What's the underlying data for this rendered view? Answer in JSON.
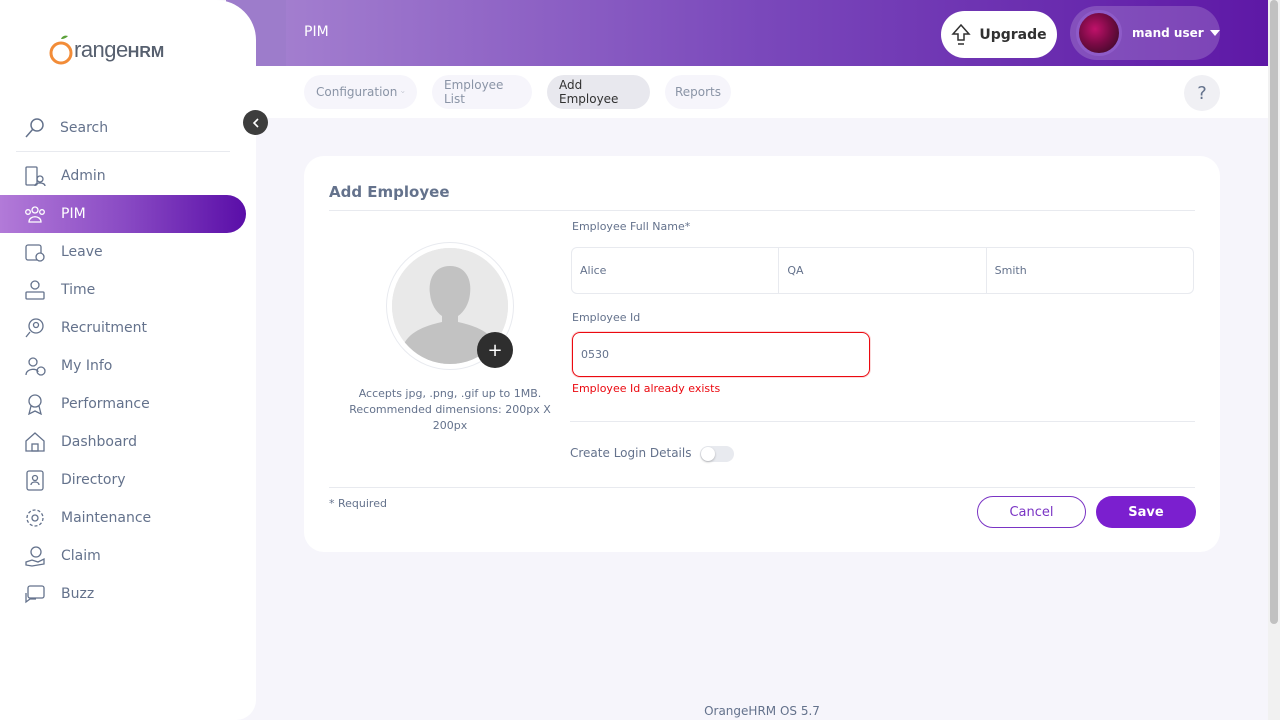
{
  "brand": {
    "o": "O",
    "rest": "range",
    "hrm": "HRM"
  },
  "sidebar": {
    "search_label": "Search",
    "items": [
      {
        "label": "Admin",
        "icon": "admin-icon"
      },
      {
        "label": "PIM",
        "icon": "pim-icon",
        "active": true
      },
      {
        "label": "Leave",
        "icon": "leave-icon"
      },
      {
        "label": "Time",
        "icon": "time-icon"
      },
      {
        "label": "Recruitment",
        "icon": "recruitment-icon"
      },
      {
        "label": "My Info",
        "icon": "my-info-icon"
      },
      {
        "label": "Performance",
        "icon": "performance-icon"
      },
      {
        "label": "Dashboard",
        "icon": "dashboard-icon"
      },
      {
        "label": "Directory",
        "icon": "directory-icon"
      },
      {
        "label": "Maintenance",
        "icon": "maintenance-icon"
      },
      {
        "label": "Claim",
        "icon": "claim-icon"
      },
      {
        "label": "Buzz",
        "icon": "buzz-icon"
      }
    ]
  },
  "header": {
    "title": "PIM",
    "upgrade_label": "Upgrade",
    "user_name": "mand user"
  },
  "subnav": {
    "tabs": [
      {
        "label": "Configuration"
      },
      {
        "label": "Employee List"
      },
      {
        "label": "Add Employee",
        "active": true
      },
      {
        "label": "Reports"
      }
    ],
    "help": "?"
  },
  "form": {
    "title": "Add Employee",
    "photo_hint": "Accepts jpg, .png, .gif up to 1MB. Recommended dimensions: 200px X 200px",
    "add_photo": "+",
    "full_name_label": "Employee Full Name*",
    "first_name": "Alice",
    "middle_name": "QA",
    "last_name": "Smith",
    "employee_id_label": "Employee Id",
    "employee_id": "0530",
    "employee_id_error": "Employee Id already exists",
    "create_login_label": "Create Login Details",
    "create_login_enabled": false,
    "required_note": "* Required",
    "cancel_label": "Cancel",
    "save_label": "Save"
  },
  "footer": {
    "text": "OrangeHRM OS 5.7"
  },
  "colors": {
    "accent": "#7b1fcf",
    "error": "#eb0910",
    "brand_orange": "#f28c38"
  }
}
